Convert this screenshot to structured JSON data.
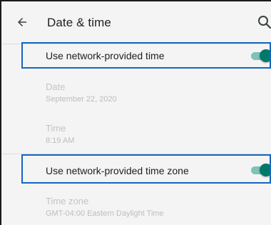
{
  "header": {
    "title": "Date & time",
    "back_icon": "arrow-back-icon",
    "search_icon": "search-icon"
  },
  "settings": {
    "network_time": {
      "label": "Use network-provided time",
      "enabled": true
    },
    "date": {
      "title": "Date",
      "value": "September 22, 2020"
    },
    "time": {
      "title": "Time",
      "value": "8:19 AM"
    },
    "network_time_zone": {
      "label": "Use network-provided time zone",
      "enabled": true
    },
    "time_zone": {
      "title": "Time zone",
      "value": "GMT-04:00 Eastern Daylight Time"
    }
  },
  "colors": {
    "highlight_border": "#1565c0",
    "toggle_thumb": "#00796b",
    "toggle_track": "#7fc2b6",
    "disabled_text": "#bdbdbd"
  }
}
